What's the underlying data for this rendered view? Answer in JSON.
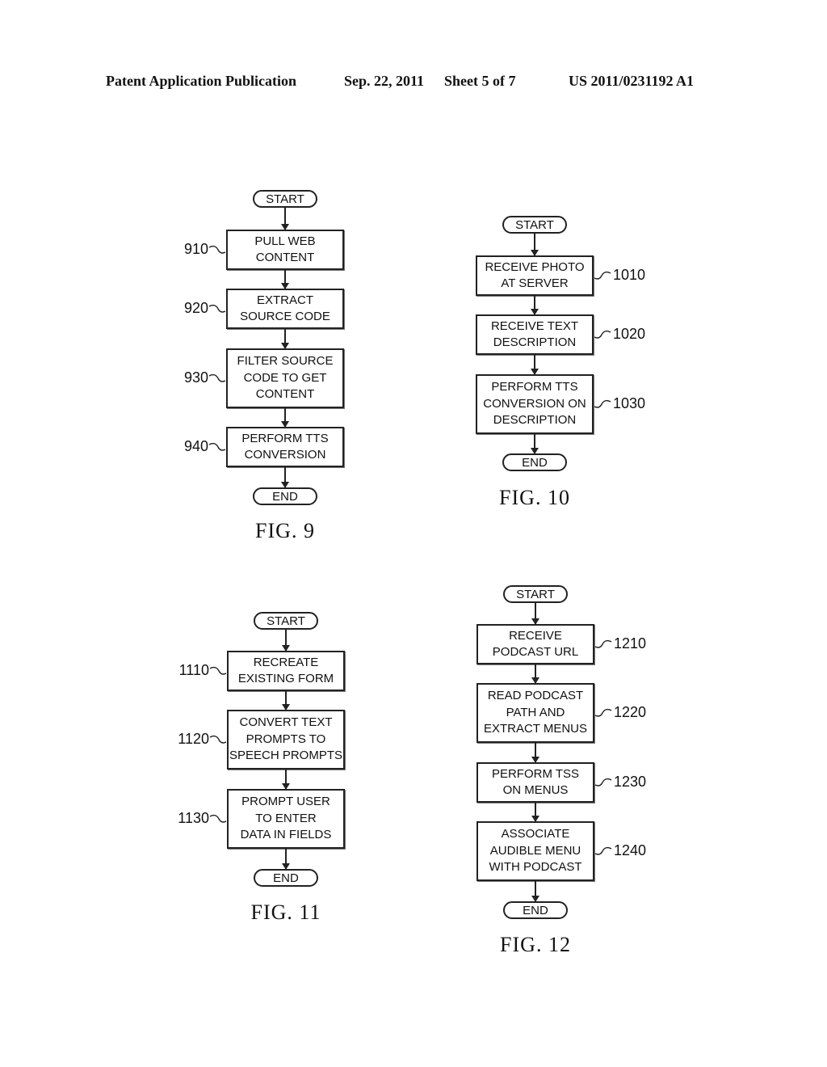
{
  "header": {
    "publication": "Patent Application Publication",
    "date": "Sep. 22, 2011",
    "sheet": "Sheet 5 of 7",
    "number": "US 2011/0231192 A1"
  },
  "figures": [
    {
      "caption": "FIG. 9",
      "start": "START",
      "end": "END",
      "steps": [
        {
          "ref": "910",
          "text": "PULL WEB\nCONTENT"
        },
        {
          "ref": "920",
          "text": "EXTRACT\nSOURCE CODE"
        },
        {
          "ref": "930",
          "text": "FILTER SOURCE\nCODE TO GET\nCONTENT"
        },
        {
          "ref": "940",
          "text": "PERFORM TTS\nCONVERSION"
        }
      ]
    },
    {
      "caption": "FIG. 10",
      "start": "START",
      "end": "END",
      "steps": [
        {
          "ref": "1010",
          "text": "RECEIVE PHOTO\nAT SERVER"
        },
        {
          "ref": "1020",
          "text": "RECEIVE TEXT\nDESCRIPTION"
        },
        {
          "ref": "1030",
          "text": "PERFORM TTS\nCONVERSION ON\nDESCRIPTION"
        }
      ]
    },
    {
      "caption": "FIG. 11",
      "start": "START",
      "end": "END",
      "steps": [
        {
          "ref": "1110",
          "text": "RECREATE\nEXISTING FORM"
        },
        {
          "ref": "1120",
          "text": "CONVERT TEXT\nPROMPTS TO\nSPEECH PROMPTS"
        },
        {
          "ref": "1130",
          "text": "PROMPT USER\nTO ENTER\nDATA IN FIELDS"
        }
      ]
    },
    {
      "caption": "FIG. 12",
      "start": "START",
      "end": "END",
      "steps": [
        {
          "ref": "1210",
          "text": "RECEIVE\nPODCAST URL"
        },
        {
          "ref": "1220",
          "text": "READ PODCAST\nPATH AND\nEXTRACT MENUS"
        },
        {
          "ref": "1230",
          "text": "PERFORM TSS\nON MENUS"
        },
        {
          "ref": "1240",
          "text": "ASSOCIATE\nAUDIBLE MENU\nWITH PODCAST"
        }
      ]
    }
  ]
}
